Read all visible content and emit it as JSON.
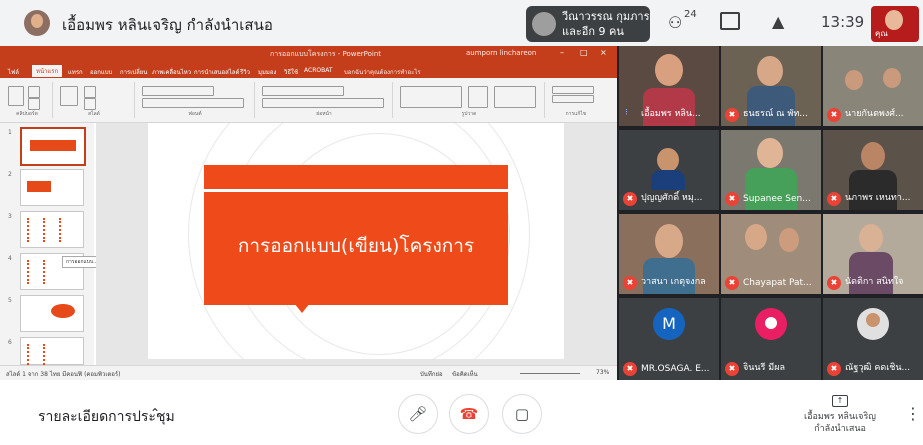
{
  "header": {
    "presenter_title": "เอื้อมพร หลินเจริญ กำลังนำเสนอ",
    "others_line1": "วีณาวรรณ กุมภาร",
    "others_line2": "และอีก 9 คน",
    "people_icon": "people-icon",
    "people_count": "24",
    "chat_icon": "chat-icon",
    "activities_icon": "activities-icon",
    "clock": "13:39",
    "self_label": "คุณ"
  },
  "ppt": {
    "window_title": "การออกแบบโครงการ - PowerPoint",
    "user": "aumporn linchareon",
    "tabs": [
      "ไฟล์",
      "หน้าแรก",
      "แทรก",
      "ออกแบบ",
      "การเปลี่ยน",
      "ภาพเคลื่อนไหว",
      "การนำเสนอสไลด์",
      "รีวิว",
      "มุมมอง",
      "วิธีใช้",
      "ACROBAT"
    ],
    "search_placeholder": "บอกฉันว่าคุณต้องการทำอะไร",
    "ribbon_groups": [
      "คลิปบอร์ด",
      "สไลด์",
      "ฟอนต์",
      "ย่อหน้า",
      "รูปวาด",
      "การแก้ไข"
    ],
    "thumb_numbers": [
      "1",
      "2",
      "3",
      "4",
      "5",
      "6"
    ],
    "tooltip": "การออกแบบ...",
    "slide_title": "การออกแบบ(เขียน)โครงการ",
    "status_left": "สไลด์ 1 จาก 38   ไทย   มีคอนฟิ (คอมพิวเตอร์)",
    "status_notes": "บันทึกย่อ",
    "status_comments": "ข้อคิดเห็น",
    "zoom": "73%"
  },
  "participants": [
    {
      "name": "เอื้อมพร หลิน...",
      "muted": false,
      "kind": "video"
    },
    {
      "name": "ธนธรณ์ ณ พัท...",
      "muted": true,
      "kind": "video"
    },
    {
      "name": "นายกันตพงศ์...",
      "muted": true,
      "kind": "video"
    },
    {
      "name": "ปุญญศักดิ์ หมุ...",
      "muted": true,
      "kind": "video"
    },
    {
      "name": "Supanee Sen...",
      "muted": true,
      "kind": "video"
    },
    {
      "name": "นภาพร เหนทา...",
      "muted": true,
      "kind": "video"
    },
    {
      "name": "วาสนา เกตุจงกล",
      "muted": true,
      "kind": "video"
    },
    {
      "name": "Chayapat Pat...",
      "muted": true,
      "kind": "video"
    },
    {
      "name": "นัดติกา สนิทใจ",
      "muted": true,
      "kind": "video"
    },
    {
      "name": "MR.OSAGA. E...",
      "muted": true,
      "kind": "avatar",
      "initial": "M",
      "color": "#1565c0"
    },
    {
      "name": "จินนรี มีผล",
      "muted": true,
      "kind": "avatar",
      "initial": "",
      "color": "#e91e63"
    },
    {
      "name": "ณัฐวุฒิ คดเชิน...",
      "muted": true,
      "kind": "photo"
    }
  ],
  "controls": {
    "meeting_details": "รายละเอียดการประชุม",
    "caret_icon": "chevron-up-icon",
    "mic_icon": "mic-icon",
    "hangup_icon": "hangup-icon",
    "camera_icon": "camera-icon",
    "present_line1": "เอื้อมพร หลินเจริญ",
    "present_line2": "กำลังนำเสนอ",
    "more_icon": "more-vert-icon"
  },
  "colors": {
    "ppt_red": "#c43e1c",
    "slide_orange": "#ee4a1a",
    "muted_red": "#ea4335"
  }
}
